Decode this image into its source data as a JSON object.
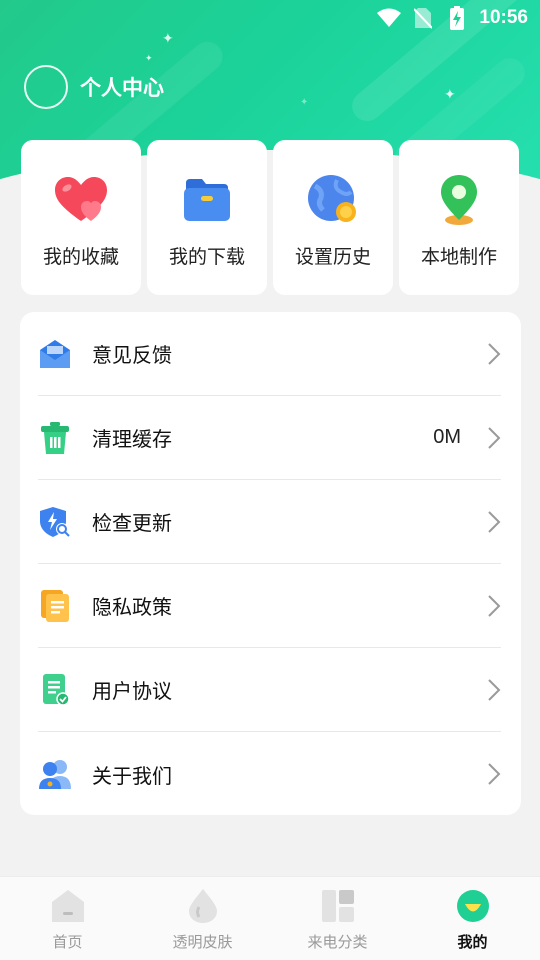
{
  "status_bar": {
    "time": "10:56"
  },
  "header": {
    "title": "个人中心"
  },
  "quick_cards": [
    {
      "label": "我的收藏",
      "icon": "heart-icon"
    },
    {
      "label": "我的下载",
      "icon": "folder-icon"
    },
    {
      "label": "设置历史",
      "icon": "globe-history-icon"
    },
    {
      "label": "本地制作",
      "icon": "location-pin-icon"
    }
  ],
  "menu": [
    {
      "label": "意见反馈",
      "value": "",
      "icon": "envelope-icon"
    },
    {
      "label": "清理缓存",
      "value": "0M",
      "icon": "trash-icon"
    },
    {
      "label": "检查更新",
      "value": "",
      "icon": "shield-update-icon"
    },
    {
      "label": "隐私政策",
      "value": "",
      "icon": "document-icon"
    },
    {
      "label": "用户协议",
      "value": "",
      "icon": "agreement-icon"
    },
    {
      "label": "关于我们",
      "value": "",
      "icon": "users-icon"
    }
  ],
  "bottom_nav": [
    {
      "label": "首页",
      "icon": "home-icon",
      "active": false
    },
    {
      "label": "透明皮肤",
      "icon": "drop-icon",
      "active": false
    },
    {
      "label": "来电分类",
      "icon": "grid-icon",
      "active": false
    },
    {
      "label": "我的",
      "icon": "profile-face-icon",
      "active": true
    }
  ],
  "colors": {
    "accent": "#1fcf94",
    "background": "#f2f2f2"
  }
}
